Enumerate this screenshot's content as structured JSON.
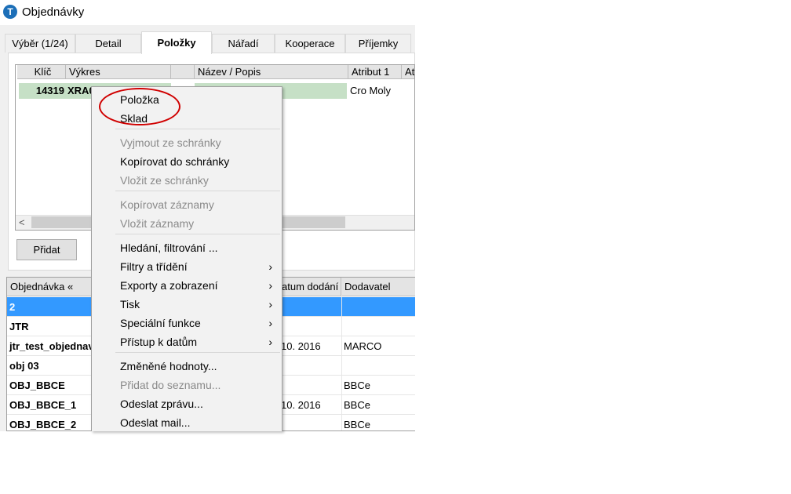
{
  "window": {
    "title": "Objednávky",
    "app_icon": "T"
  },
  "tabs": [
    {
      "label": "Výběr (1/24)"
    },
    {
      "label": "Detail"
    },
    {
      "label": "Položky",
      "active": true
    },
    {
      "label": "Nářadí"
    },
    {
      "label": "Kooperace"
    },
    {
      "label": "Příjemky"
    }
  ],
  "items_grid": {
    "headers": [
      "Klíč",
      "Výkres",
      "",
      "Název / Popis",
      "Atribut 1",
      "Atr"
    ],
    "row": {
      "key": "14319",
      "drawing": "XRA0",
      "name": "",
      "attr1": "Cro Moly"
    }
  },
  "buttons": {
    "add": "Přidat"
  },
  "orders_grid": {
    "headers": [
      "Objednávka «",
      "atum dodání",
      "Dodavatel"
    ],
    "rows": [
      {
        "order": "2",
        "date": "",
        "supplier": "",
        "selected": true
      },
      {
        "order": "JTR",
        "date": "",
        "supplier": ""
      },
      {
        "order": "jtr_test_objednav",
        "date": "10. 2016",
        "supplier": "MARCO"
      },
      {
        "order": "obj 03",
        "date": "",
        "supplier": ""
      },
      {
        "order": "OBJ_BBCE",
        "date": "",
        "supplier": "BBCe"
      },
      {
        "order": "OBJ_BBCE_1",
        "date": "10. 2016",
        "supplier": "BBCe"
      },
      {
        "order": "OBJ_BBCE_2",
        "date": "",
        "supplier": "BBCe"
      }
    ]
  },
  "context_menu": {
    "items": [
      {
        "label": "Položka",
        "enabled": true
      },
      {
        "label": "Sklad",
        "enabled": true
      },
      {
        "label": "Vyjmout ze schránky",
        "enabled": false
      },
      {
        "label": "Kopírovat do schránky",
        "enabled": true
      },
      {
        "label": "Vložit ze schránky",
        "enabled": false
      },
      {
        "label": "Kopírovat záznamy",
        "enabled": false
      },
      {
        "label": "Vložit záznamy",
        "enabled": false
      },
      {
        "label": "Hledání, filtrování ...",
        "enabled": true
      },
      {
        "label": "Filtry a třídění",
        "enabled": true,
        "submenu": true
      },
      {
        "label": "Exporty a zobrazení",
        "enabled": true,
        "submenu": true
      },
      {
        "label": "Tisk",
        "enabled": true,
        "submenu": true
      },
      {
        "label": "Speciální funkce",
        "enabled": true,
        "submenu": true
      },
      {
        "label": "Přístup k datům",
        "enabled": true,
        "submenu": true
      },
      {
        "label": "Změněné hodnoty...",
        "enabled": true
      },
      {
        "label": "Přidat do seznamu...",
        "enabled": false
      },
      {
        "label": "Odeslat zprávu...",
        "enabled": true
      },
      {
        "label": "Odeslat mail...",
        "enabled": true
      }
    ],
    "submenu_arrow": "›"
  },
  "colors": {
    "selection": "#3399ff",
    "row_highlight": "#c6e0c6",
    "annotation": "#d00000"
  }
}
